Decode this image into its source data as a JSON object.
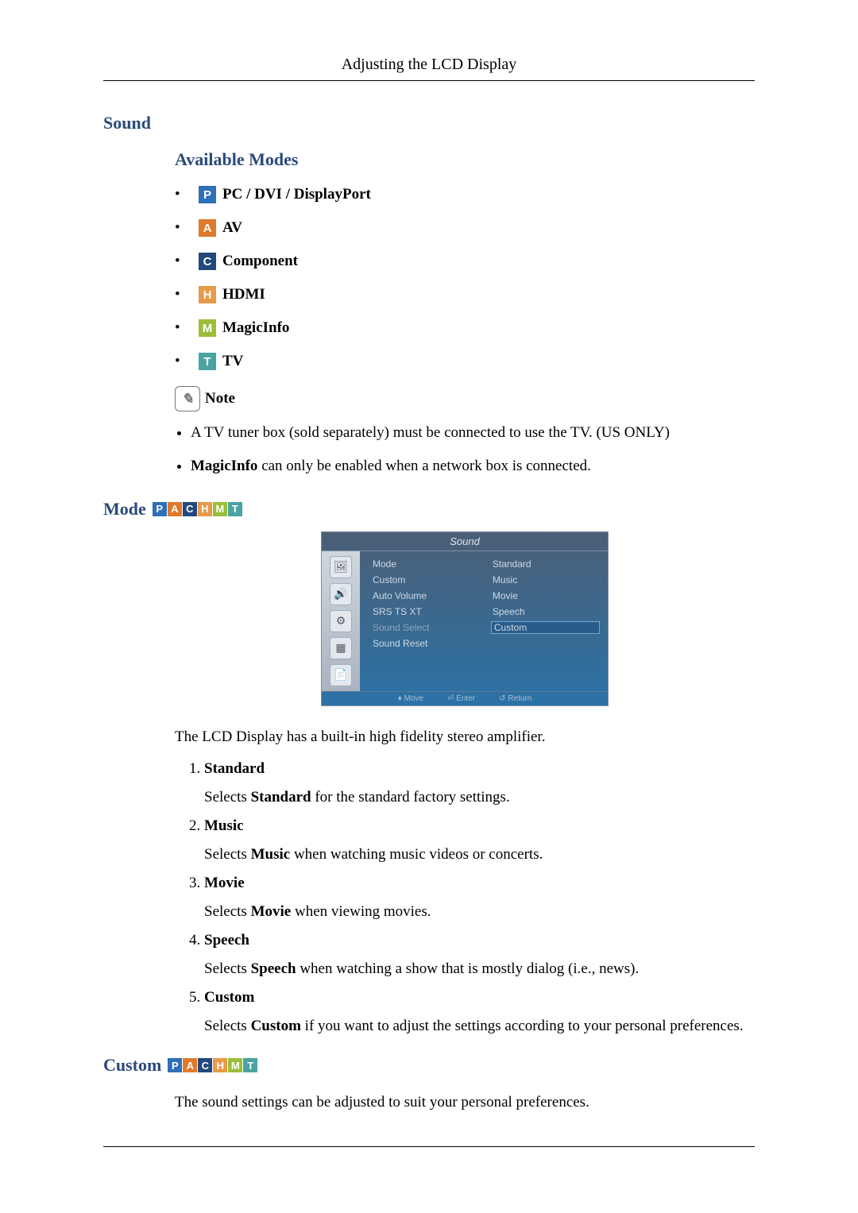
{
  "header": {
    "title": "Adjusting the LCD Display"
  },
  "sections": {
    "sound": {
      "title": "Sound"
    },
    "available_modes": {
      "title": "Available Modes",
      "items": [
        {
          "letter": "P",
          "label": "PC / DVI / DisplayPort"
        },
        {
          "letter": "A",
          "label": "AV"
        },
        {
          "letter": "C",
          "label": "Component"
        },
        {
          "letter": "H",
          "label": "HDMI"
        },
        {
          "letter": "M",
          "label": "MagicInfo"
        },
        {
          "letter": "T",
          "label": "TV"
        }
      ]
    },
    "note": {
      "label": "Note",
      "items": [
        {
          "text": "A TV tuner box (sold separately) must be connected to use the TV. (US ONLY)"
        },
        {
          "bold": "MagicInfo",
          "rest": " can only be enabled when a network box is connected."
        }
      ]
    },
    "mode": {
      "title": "Mode",
      "osd": {
        "title": "Sound",
        "left": [
          "Mode",
          "Custom",
          "Auto Volume",
          "SRS TS XT",
          "Sound Select",
          "Sound Reset"
        ],
        "right": [
          "Standard",
          "Music",
          "Movie",
          "Speech",
          "Custom"
        ],
        "hints": [
          "Move",
          "Enter",
          "Return"
        ]
      },
      "intro": "The LCD Display has a built-in high fidelity stereo amplifier.",
      "list": [
        {
          "name": "Standard",
          "desc_pre": "Selects ",
          "desc_bold": "Standard",
          "desc_post": " for the standard factory settings."
        },
        {
          "name": "Music",
          "desc_pre": "Selects ",
          "desc_bold": "Music",
          "desc_post": " when watching music videos or concerts."
        },
        {
          "name": "Movie",
          "desc_pre": "Selects ",
          "desc_bold": "Movie",
          "desc_post": " when viewing movies."
        },
        {
          "name": "Speech",
          "desc_pre": "Selects ",
          "desc_bold": "Speech",
          "desc_post": " when watching a show that is mostly dialog (i.e., news)."
        },
        {
          "name": "Custom",
          "desc_pre": "Selects ",
          "desc_bold": "Custom",
          "desc_post": " if you want to adjust the settings according to your personal preferences."
        }
      ]
    },
    "custom": {
      "title": "Custom",
      "text": "The sound settings can be adjusted to suit your personal preferences."
    }
  },
  "icon_strip": {
    "letters": [
      "P",
      "A",
      "C",
      "H",
      "M",
      "T"
    ]
  }
}
